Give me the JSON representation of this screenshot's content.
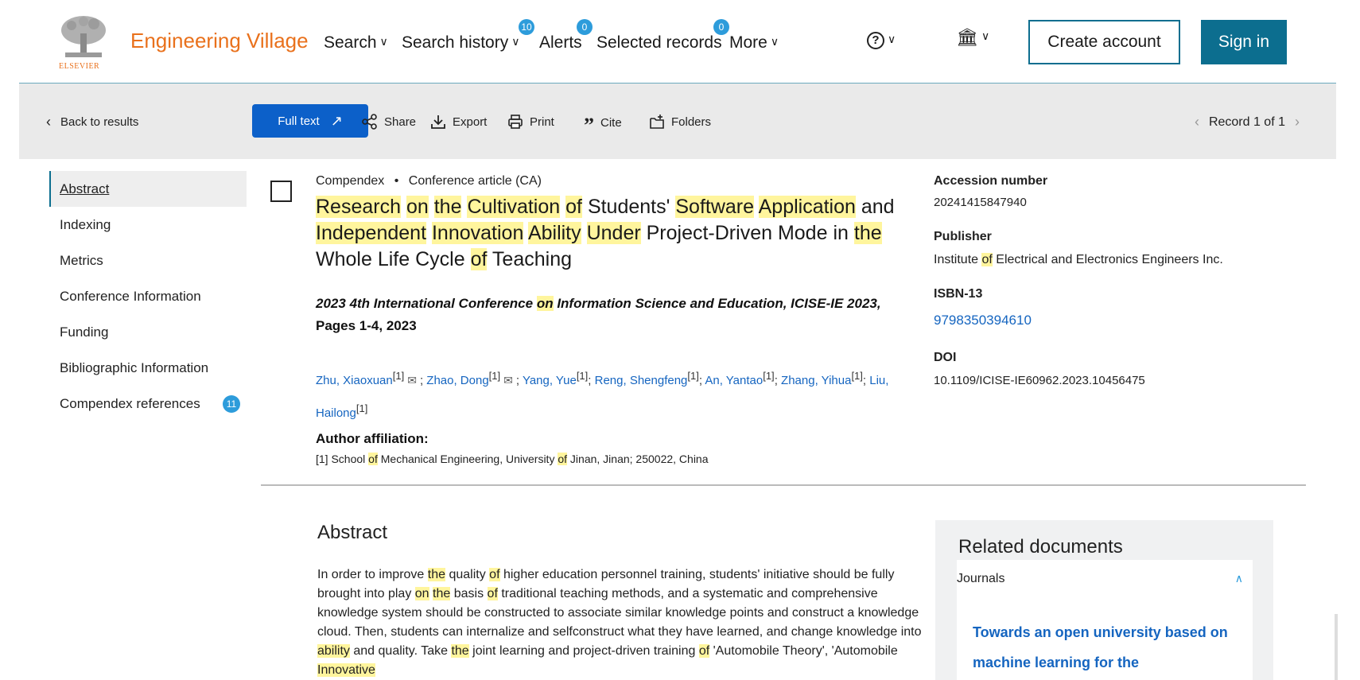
{
  "header": {
    "brand": "Engineering Village",
    "logo_text": "ELSEVIER",
    "nav": [
      {
        "label": "Search",
        "has_chevron": true
      },
      {
        "label": "Search history",
        "badge": "10",
        "has_chevron": true
      },
      {
        "label": "Alerts",
        "badge": "0"
      },
      {
        "label": "Selected records",
        "badge": "0"
      },
      {
        "label": "More",
        "has_chevron": true
      }
    ],
    "help_icon": "?",
    "institution_icon": "institution-icon",
    "create_account": "Create account",
    "sign_in": "Sign in"
  },
  "toolbar": {
    "back": "Back to results",
    "full_text": "Full text",
    "share": "Share",
    "export": "Export",
    "print": "Print",
    "cite": "Cite",
    "folders": "Folders",
    "record": "Record 1 of 1"
  },
  "sidenav": {
    "items": [
      {
        "label": "Abstract"
      },
      {
        "label": "Indexing"
      },
      {
        "label": "Metrics"
      },
      {
        "label": "Conference Information"
      },
      {
        "label": "Funding"
      },
      {
        "label": "Bibliographic Information"
      },
      {
        "label": "Compendex references",
        "count": "11"
      }
    ]
  },
  "record": {
    "database": "Compendex",
    "doc_type": "Conference article (CA)",
    "title": "Research on the Cultivation of Students' Software Application and Independent Innovation Ability Under Project-Driven Mode in the Whole Life Cycle of Teaching",
    "conference": "2023 4th International Conference on Information Science and Education, ICISE-IE 2023,",
    "pages": "Pages 1-4, 2023",
    "authors": [
      {
        "name": "Zhu, Xiaoxuan",
        "aff": "[1]",
        "email": true
      },
      {
        "name": "Zhao, Dong",
        "aff": "[1]",
        "email": true
      },
      {
        "name": "Yang, Yue",
        "aff": "[1]"
      },
      {
        "name": "Reng, Shengfeng",
        "aff": "[1]"
      },
      {
        "name": "An, Yantao",
        "aff": "[1]"
      },
      {
        "name": "Zhang, Yihua",
        "aff": "[1]"
      },
      {
        "name": "Liu, Hailong",
        "aff": "[1]"
      }
    ],
    "affiliation_label": "Author affiliation:",
    "affiliation": "[1] School of Mechanical Engineering, University of Jinan, Jinan; 250022, China"
  },
  "meta": {
    "accession_label": "Accession number",
    "accession": "20241415847940",
    "publisher_label": "Publisher",
    "publisher": "Institute of Electrical and Electronics Engineers Inc.",
    "isbn_label": "ISBN-13",
    "isbn": "9798350394610",
    "doi_label": "DOI",
    "doi": "10.1109/ICISE-IE60962.2023.10456475"
  },
  "abstract": {
    "heading": "Abstract",
    "text": "In order to improve the quality of higher education personnel training, students' initiative should be fully brought into play on the basis of traditional teaching methods, and a systematic and comprehensive knowledge system should be constructed to associate similar knowledge points and construct a knowledge cloud. Then, students can internalize and selfconstruct what they have learned, and change knowledge into ability and quality. Take the joint learning and project-driven training of 'Automobile Theory', 'Automobile Innovative"
  },
  "related": {
    "heading": "Related documents",
    "tab": "Journals",
    "first_title": "Towards an open university based on machine learning for the"
  },
  "highlight_terms": [
    "Research",
    "on",
    "the",
    "Cultivation",
    "of",
    "Software",
    "Application",
    "Independent",
    "Innovation",
    "Ability",
    "Under",
    "ability",
    "Innovative"
  ],
  "colors": {
    "accent": "#0c6e8f",
    "brand": "#e9711c",
    "link": "#1565c0",
    "highlight": "#fff59d",
    "badge": "#2d9cdb"
  }
}
